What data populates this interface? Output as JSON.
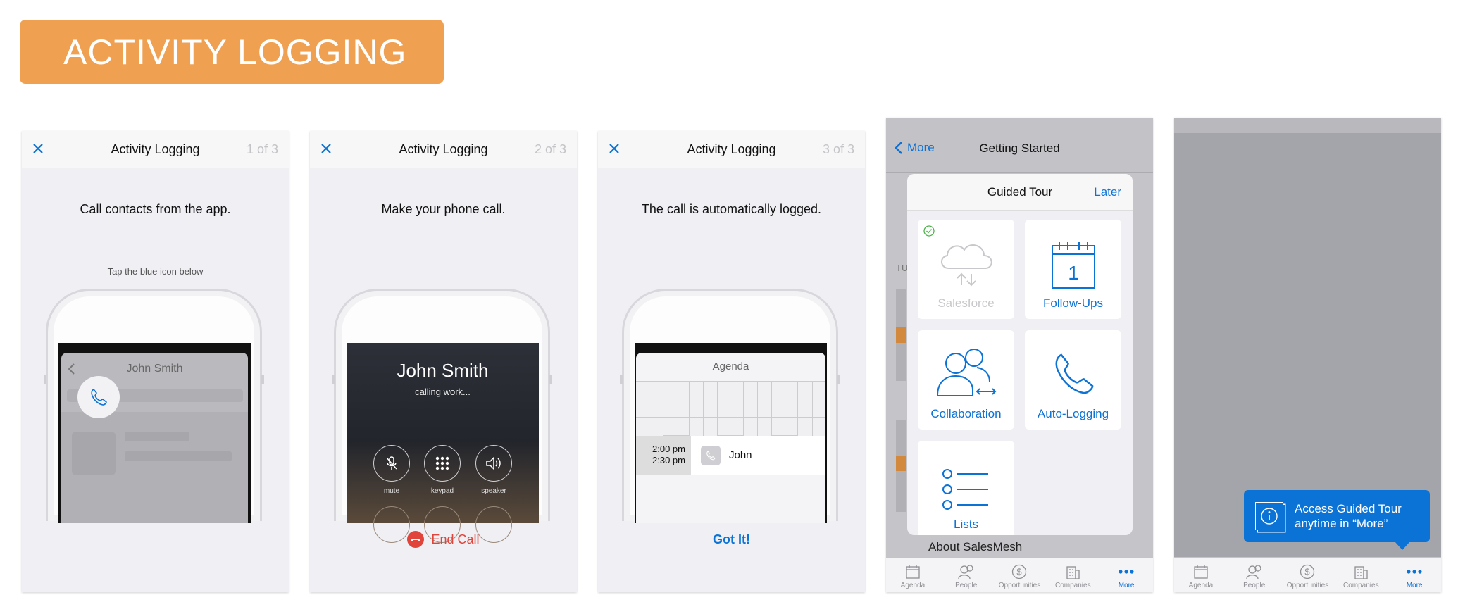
{
  "banner": {
    "title": "ACTIVITY LOGGING"
  },
  "colors": {
    "banner": "#f0a051",
    "accent": "#0b72d6",
    "end_call": "#e0443a"
  },
  "panels": [
    {
      "title": "Activity Logging",
      "step": "1 of 3",
      "message": "Call contacts from the app.",
      "hint": "Tap the blue icon below",
      "contact": "John Smith"
    },
    {
      "title": "Activity Logging",
      "step": "2 of 3",
      "message": "Make your phone call.",
      "caller": "John Smith",
      "status": "calling work...",
      "buttons": [
        "mute",
        "keypad",
        "speaker"
      ],
      "action": "End Call"
    },
    {
      "title": "Activity Logging",
      "step": "3 of 3",
      "message": "The call is automatically logged.",
      "calendar_title": "Agenda",
      "event_start": "2:00 pm",
      "event_end": "2:30 pm",
      "event_name": "John",
      "action": "Got It!"
    }
  ],
  "tour": {
    "back": "More",
    "nav_title": "Getting Started",
    "modal_title": "Guided Tour",
    "later": "Later",
    "tiles": [
      {
        "label": "Salesforce",
        "icon": "cloud-sync-icon",
        "completed": true
      },
      {
        "label": "Follow-Ups",
        "icon": "calendar-icon",
        "day": "1"
      },
      {
        "label": "Collaboration",
        "icon": "people-icon"
      },
      {
        "label": "Auto-Logging",
        "icon": "phone-icon"
      },
      {
        "label": "Lists",
        "icon": "list-icon"
      }
    ],
    "background_peek": "About SalesMesh",
    "section_peek": "TU"
  },
  "tooltip": {
    "text_line1": "Access Guided Tour",
    "text_line2": "anytime in “More”"
  },
  "tabbar": [
    {
      "label": "Agenda",
      "icon": "calendar-icon"
    },
    {
      "label": "People",
      "icon": "people-icon"
    },
    {
      "label": "Opportunities",
      "icon": "dollar-icon"
    },
    {
      "label": "Companies",
      "icon": "building-icon"
    },
    {
      "label": "More",
      "icon": "more-icon",
      "active": true
    }
  ]
}
